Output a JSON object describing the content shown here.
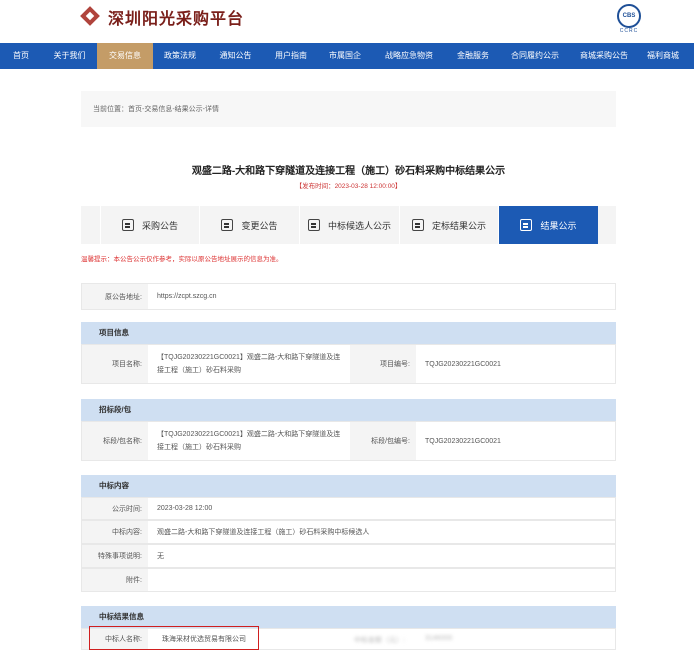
{
  "brand": {
    "name": "深圳阳光采购平台",
    "badge_top": "CBS",
    "badge_bottom": "CCRC"
  },
  "nav": [
    "首页",
    "关于我们",
    "交易信息",
    "政策法规",
    "通知公告",
    "用户指南",
    "市属国企",
    "战略应急物资",
    "金融服务",
    "合同履约公示",
    "商城采购公告",
    "福利商城"
  ],
  "breadcrumb": "当前位置：首页-交易信息-结果公示-详情",
  "title": "观盛二路-大和路下穿隧道及连接工程（施工）砂石料采购中标结果公示",
  "pub_date": "【发布时间：2023-03-28 12:00:00】",
  "tabs": [
    "采购公告",
    "变更公告",
    "中标候选人公示",
    "定标结果公示",
    "结果公示"
  ],
  "notice": "温馨提示：本公告公示仅作参考，实际以原公告地址展示的信息为准。",
  "original": {
    "label": "原公告地址:",
    "value": "https://zcpt.szcg.cn"
  },
  "project": {
    "header": "项目信息",
    "name_label": "项目名称:",
    "name_value": "【TQJG20230221GC0021】观盛二路-大和路下穿隧道及连接工程（施工）砂石料采购",
    "code_label": "项目编号:",
    "code_value": "TQJG20230221GC0021"
  },
  "section": {
    "header": "招标段/包",
    "name_label": "标段/包名称:",
    "name_value": "【TQJG20230221GC0021】观盛二路-大和路下穿隧道及连接工程（施工）砂石料采购",
    "code_label": "标段/包编号:",
    "code_value": "TQJG20230221GC0021"
  },
  "award": {
    "header": "中标内容",
    "time_label": "公示时间:",
    "time_value": "2023-03-28 12:00",
    "content_label": "中标内容:",
    "content_value": "观盛二路-大和路下穿隧道及连接工程（施工）砂石料采购中标候选人",
    "special_label": "特殊事项说明:",
    "special_value": "无",
    "attach_label": "附件:"
  },
  "result": {
    "header": "中标结果信息",
    "winner_label": "中标人名称:",
    "winner_value": "珠海采材优选贸易有限公司",
    "blur_label": "中标金额（元）:",
    "blur_value": "3146000"
  }
}
